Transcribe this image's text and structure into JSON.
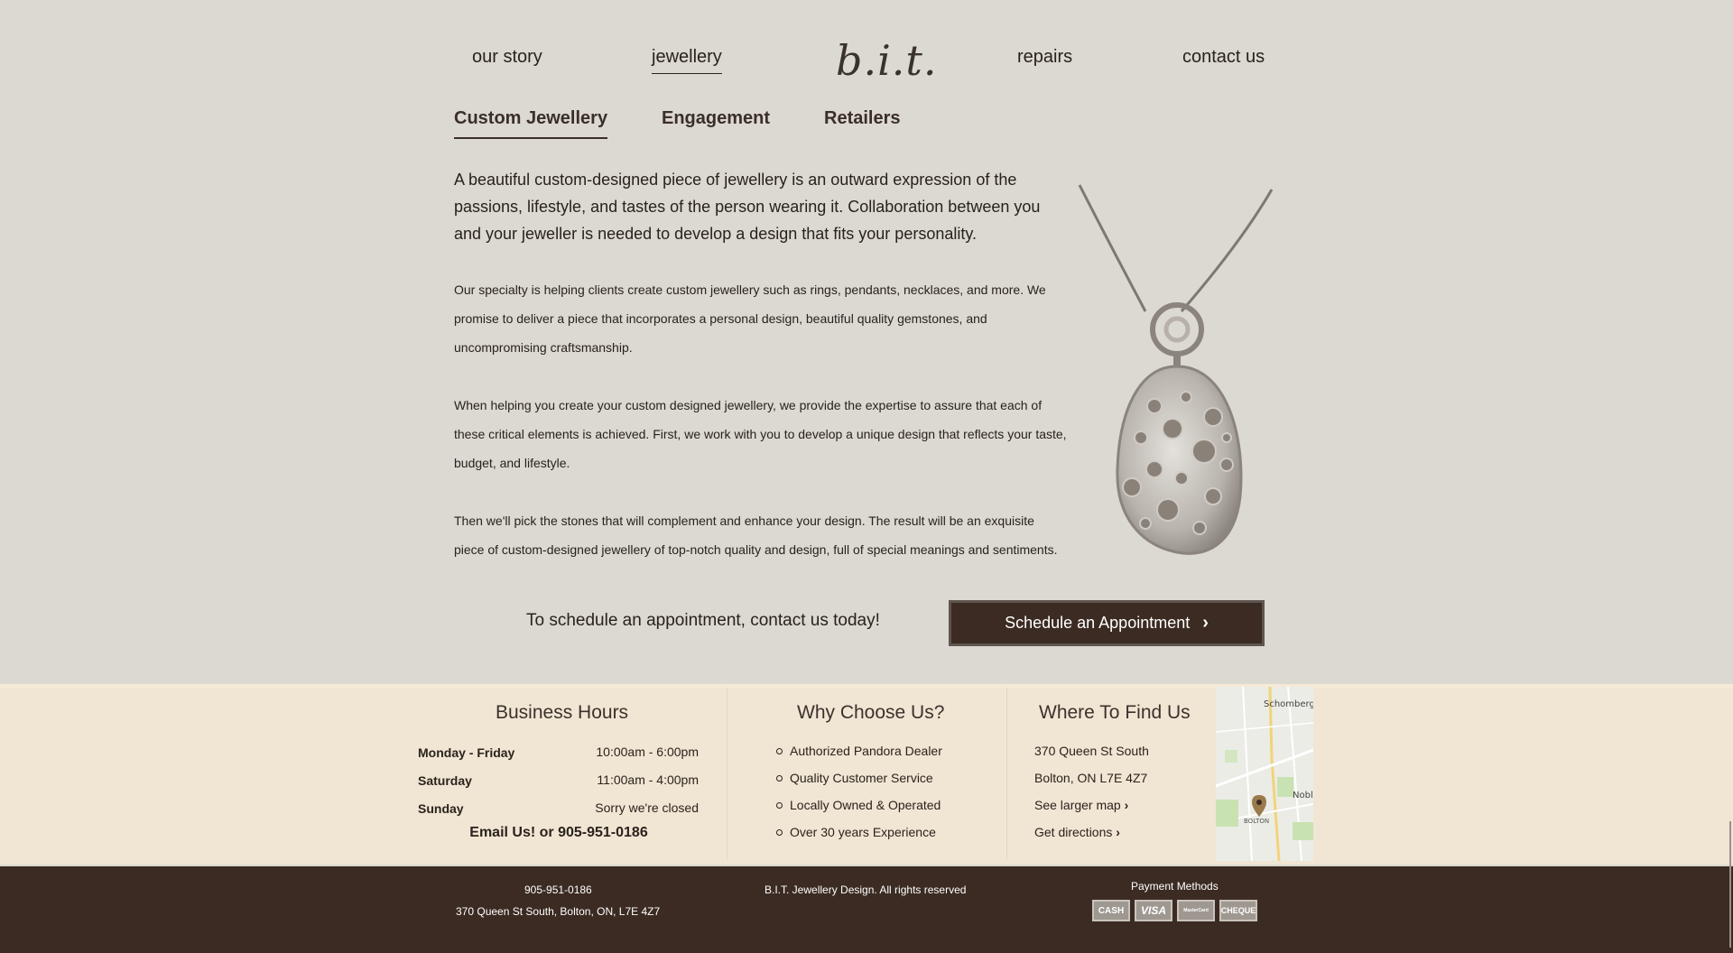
{
  "nav": {
    "our_story": "our story",
    "jewellery": "jewellery",
    "logo": "b.i.t.",
    "repairs": "repairs",
    "contact": "contact us"
  },
  "tabs": {
    "custom": "Custom Jewellery",
    "engagement": "Engagement",
    "retailers": "Retailers"
  },
  "content": {
    "lead": "A beautiful custom-designed piece of jewellery is an outward expression of the passions, lifestyle, and tastes of the person wearing it. Collaboration between you and your jeweller is needed to develop a design that fits your personality.",
    "p1": "Our specialty is helping clients create custom jewellery such as rings, pendants, necklaces, and more. We promise to deliver a piece that incorporates a personal design, beautiful quality gemstones, and uncompromising craftsmanship.",
    "p2": "When helping you create your custom designed jewellery, we provide the expertise to assure that each of these critical elements is achieved. First, we work with you to develop a unique design that reflects your taste, budget, and lifestyle.",
    "p3": "Then we'll pick the stones that will complement and enhance your design. The result will be an exquisite piece of custom-designed jewellery of top-notch quality and design, full of special meanings and sentiments."
  },
  "cta": {
    "text": "To schedule an appointment, contact us today!",
    "button": "Schedule an Appointment"
  },
  "hours": {
    "title": "Business Hours",
    "rows": [
      {
        "day": "Monday - Friday",
        "time": "10:00am - 6:00pm"
      },
      {
        "day": "Saturday",
        "time": "11:00am - 4:00pm"
      },
      {
        "day": "Sunday",
        "time": "Sorry we're closed"
      }
    ],
    "email_line": "Email Us! or 905-951-0186"
  },
  "why": {
    "title": "Why Choose Us?",
    "items": [
      "Authorized Pandora Dealer",
      "Quality Customer Service",
      "Locally Owned & Operated",
      "Over 30 years Experience"
    ]
  },
  "find": {
    "title": "Where To Find Us",
    "address1": "370 Queen St South",
    "address2": "Bolton, ON L7E 4Z7",
    "larger_map": "See larger map",
    "directions": "Get directions",
    "map_labels": {
      "schomberg": "Schomberg",
      "nobleton": "Noble",
      "bolton": "BOLTON"
    }
  },
  "footer": {
    "phone": "905-951-0186",
    "address": "370 Queen St South, Bolton, ON, L7E 4Z7",
    "copyright": "B.I.T. Jewellery Design. All rights reserved",
    "payment_title": "Payment Methods",
    "payments": [
      "CASH",
      "VISA",
      "MasterCard",
      "CHEQUE"
    ]
  },
  "colors": {
    "page_bg": "#dcd8d2",
    "brown": "#3b2b22",
    "info_band": "#f1e6d4"
  }
}
